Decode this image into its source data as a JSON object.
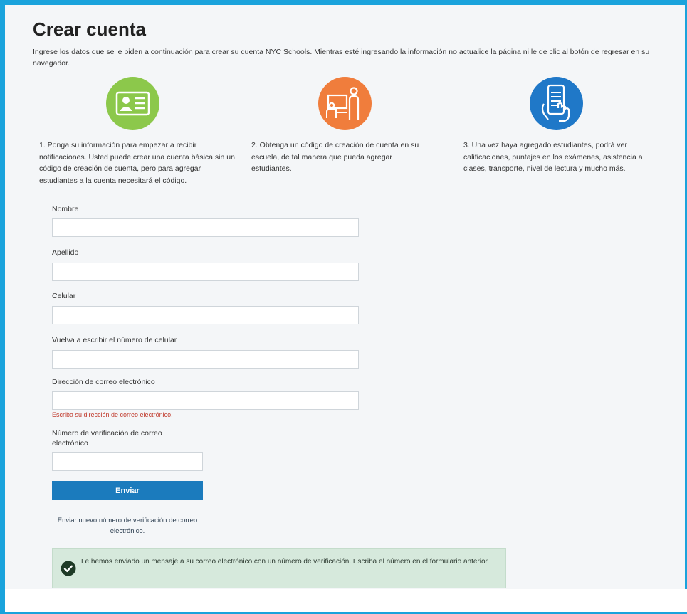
{
  "header": {
    "title": "Crear cuenta",
    "intro": "Ingrese los datos que se le piden a continuación para crear su cuenta NYC Schools. Mientras esté ingresando la información no actualice la página ni le de clic al botón de regresar en su navegador."
  },
  "steps": [
    {
      "icon": "id-card-icon",
      "color": "#8cc84b",
      "text": "1. Ponga su información para empezar a recibir notificaciones. Usted puede crear una cuenta básica sin un código de creación de cuenta, pero para agregar estudiantes a la cuenta necesitará el código."
    },
    {
      "icon": "classroom-icon",
      "color": "#f07d3c",
      "text": "2. Obtenga un código de creación de cuenta en su escuela, de tal manera que pueda agregar estudiantes."
    },
    {
      "icon": "phone-tap-icon",
      "color": "#1f78c8",
      "text": "3. Una vez haya agregado estudiantes, podrá ver calificaciones, puntajes en los exámenes, asistencia a clases, transporte, nivel de lectura y mucho más."
    }
  ],
  "form": {
    "first_name_label": "Nombre",
    "first_name_value": "",
    "last_name_label": "Apellido",
    "last_name_value": "",
    "mobile_label": "Celular",
    "mobile_value": "",
    "mobile_confirm_label": "Vuelva a escribir el número de celular",
    "mobile_confirm_value": "",
    "email_label": "Dirección de correo electrónico",
    "email_value": "",
    "email_error": "Escriba su dirección de correo electrónico.",
    "verification_label": "Número de verificación de correo electrónico",
    "verification_value": "",
    "submit_label": "Enviar",
    "resend_label": "Enviar nuevo número de verificación de correo electrónico."
  },
  "alert": {
    "icon": "check-circle-icon",
    "text": "Le hemos enviado un mensaje a su correo electrónico con un número de verificación. Escriba el número en el formulario anterior."
  },
  "colors": {
    "frame_border": "#1aa3dc",
    "button": "#1b7bbd",
    "error": "#c0392b",
    "alert_bg": "#d6e9dc"
  }
}
